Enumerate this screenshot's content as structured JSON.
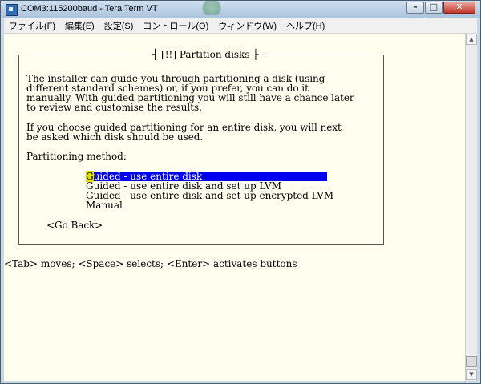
{
  "window": {
    "title": "COM3:115200baud - Tera Term VT",
    "minimize_glyph": "–",
    "maximize_glyph": "□",
    "close_glyph": "✕"
  },
  "menu": [
    "ファイル(F)",
    "編集(E)",
    "設定(S)",
    "コントロール(O)",
    "ウィンドウ(W)",
    "ヘルプ(H)"
  ],
  "dialog": {
    "title": "[!!] Partition disks",
    "intro_lines": [
      "The installer can guide you through partitioning a disk (using",
      "different standard schemes) or, if you prefer, you can do it",
      "manually. With guided partitioning you will still have a chance later",
      "to review and customise the results."
    ],
    "guided_lines": [
      "If you choose guided partitioning for an entire disk, you will next",
      "be asked which disk should be used."
    ],
    "method_label": "Partitioning method:",
    "options": [
      "Guided - use entire disk",
      "Guided - use entire disk and set up LVM",
      "Guided - use entire disk and set up encrypted LVM",
      "Manual"
    ],
    "selected_option_first_char": "G",
    "selected_option_rest": "uided - use entire disk",
    "go_back": "<Go Back>"
  },
  "status_line": "<Tab> moves; <Space> selects; <Enter> activates buttons",
  "colors": {
    "terminal_bg": "#fffff0",
    "selection_bg": "#0000ee",
    "cursor_bg": "#e6e000"
  }
}
